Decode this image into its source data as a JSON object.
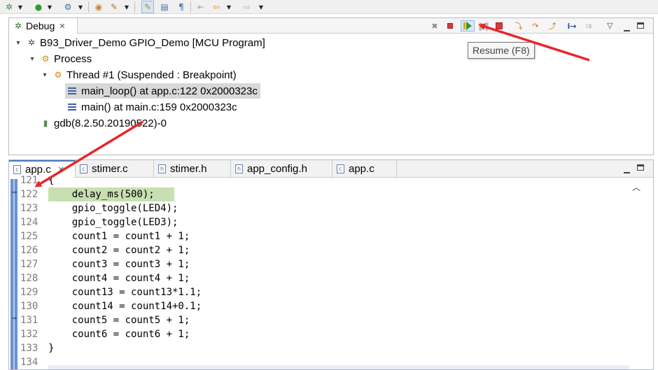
{
  "debug_view": {
    "tab_label": "Debug",
    "tooltip": "Resume (F8)",
    "tree": {
      "launch": "B93_Driver_Demo GPIO_Demo [MCU Program]",
      "process": "Process",
      "thread": "Thread #1 (Suspended : Breakpoint)",
      "frames": [
        "main_loop() at app.c:122 0x2000323c",
        "main() at main.c:159 0x2000323c"
      ],
      "gdb": "gdb(8.2.50.20190522)-0"
    }
  },
  "editor": {
    "tabs": [
      "app.c",
      "stimer.c",
      "stimer.h",
      "app_config.h",
      "app.c"
    ],
    "active_tab_index": 0,
    "lines": [
      {
        "num": "121",
        "code": "{"
      },
      {
        "num": "122",
        "code": "    delay_ms(500);",
        "current": true
      },
      {
        "num": "123",
        "code": "    gpio_toggle(LED4);"
      },
      {
        "num": "124",
        "code": "    gpio_toggle(LED3);"
      },
      {
        "num": "125",
        "code": "    count1 = count1 + 1;"
      },
      {
        "num": "126",
        "code": "    count2 = count2 + 1;"
      },
      {
        "num": "127",
        "code": "    count3 = count3 + 1;"
      },
      {
        "num": "128",
        "code": "    count4 = count4 + 1;"
      },
      {
        "num": "129",
        "code": "    count13 = count13*1.1;"
      },
      {
        "num": "130",
        "code": "    count14 = count14+0.1;"
      },
      {
        "num": "131",
        "code": "    count5 = count5 + 1;"
      },
      {
        "num": "132",
        "code": "    count6 = count6 + 1;"
      },
      {
        "num": "133",
        "code": "}"
      },
      {
        "num": "134",
        "code": ""
      }
    ]
  },
  "colors": {
    "current_line": "#c7dfb1",
    "selection": "#d8d8d8",
    "annotation_arrow": "#e8262c",
    "ruler": "#6b92d0"
  },
  "icons": {
    "debug_toolbar": [
      "remove-all-terminated-icon",
      "stop-icon-red",
      "resume-icon",
      "suspend-icon",
      "terminate-icon",
      "step-into-icon",
      "step-over-icon",
      "step-return-icon",
      "instruction-stepping-icon",
      "use-step-filters-icon",
      "view-menu-icon",
      "minimize-icon",
      "maximize-icon"
    ]
  }
}
